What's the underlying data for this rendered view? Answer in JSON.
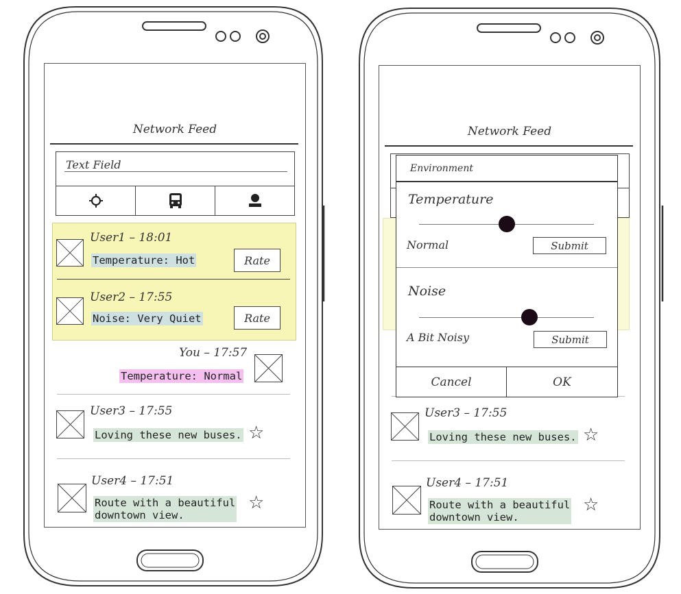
{
  "feed_title": "Network Feed",
  "search": {
    "placeholder": "Text Field"
  },
  "tabs": [
    {
      "icon": "sun-icon"
    },
    {
      "icon": "bus-icon"
    },
    {
      "icon": "person-icon"
    }
  ],
  "rate_label": "Rate",
  "posts": [
    {
      "user": "User1 – 18:01",
      "message": "Temperature: Hot"
    },
    {
      "user": "User2 – 17:55",
      "message": "Noise: Very Quiet"
    },
    {
      "user": "You – 17:57",
      "message": "Temperature: Normal"
    },
    {
      "user": "User3 – 17:55",
      "message": "Loving these new buses."
    },
    {
      "user": "User4 – 17:51",
      "message_line1": "Route with a beautiful",
      "message_line2": "downtown view."
    }
  ],
  "dialog": {
    "title": "Environment",
    "temperature": {
      "label": "Temperature",
      "value_text": "Normal",
      "submit": "Submit",
      "level": 0.5
    },
    "noise": {
      "label": "Noise",
      "value_text": "A Bit Noisy",
      "submit": "Submit",
      "level": 0.63
    },
    "cancel": "Cancel",
    "ok": "OK"
  },
  "colors": {
    "highlight_yellow": "#f7f6b7",
    "message_green": "#d5e5d8",
    "message_pink": "#f5c0ef",
    "knob": "#1a0b16"
  }
}
